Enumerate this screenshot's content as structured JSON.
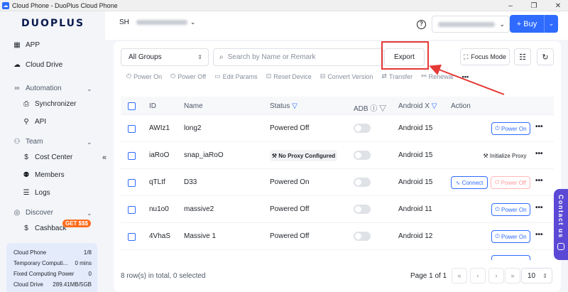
{
  "window": {
    "title": "Cloud Phone - DuoPlus Cloud Phone",
    "controls": [
      "–",
      "❐",
      "✕"
    ]
  },
  "sidebar": {
    "logo": "DUOPLUS",
    "items": [
      {
        "label": "APP",
        "icon": "grid-icon"
      },
      {
        "label": "Cloud Drive",
        "icon": "cloud-icon"
      },
      {
        "label": "Automation",
        "icon": "infinity-icon",
        "section": true
      },
      {
        "label": "Synchronizer",
        "icon": "sync-icon"
      },
      {
        "label": "API",
        "icon": "api-icon"
      },
      {
        "label": "Team",
        "icon": "team-icon",
        "section": true
      },
      {
        "label": "Cost Center",
        "icon": "dollar-icon"
      },
      {
        "label": "Members",
        "icon": "members-icon"
      },
      {
        "label": "Logs",
        "icon": "logs-icon"
      },
      {
        "label": "Discover",
        "icon": "compass-icon",
        "section": true
      },
      {
        "label": "Cashback",
        "icon": "cashback-icon"
      }
    ],
    "cashback_badge": "GET $$$",
    "stats": [
      {
        "label": "Cloud Phone",
        "value": "1/8"
      },
      {
        "label": "Temporary Computi...",
        "value": "0 mins"
      },
      {
        "label": "Fixed Computing Power",
        "value": "0"
      },
      {
        "label": "Cloud Drive",
        "value": "289.41MB/5GB"
      }
    ],
    "collapse_glyph": "«"
  },
  "header": {
    "account_initials": "SH",
    "help_glyph": "?",
    "buy_label": "+ Buy"
  },
  "toolbar": {
    "group_select": "All Groups",
    "search_placeholder": "Search by Name or Remark",
    "export_label": "Export",
    "focus_mode_label": "Focus Mode",
    "actions": [
      "Power On",
      "Power Off",
      "Edit Params",
      "Reset Device",
      "Convert Version",
      "Transfer",
      "Renewal"
    ],
    "more_glyph": "•••"
  },
  "table": {
    "columns": [
      "ID",
      "Name",
      "Status",
      "ADB",
      "Android X",
      "Action"
    ],
    "rows": [
      {
        "id": "AWIz1",
        "name": "long2",
        "status": "Powered Off",
        "android": "Android 15",
        "actions": [
          "Power On"
        ]
      },
      {
        "id": "iaRoO",
        "name": "snap_iaRoO",
        "status": "No Proxy Configured",
        "android": "Android 15",
        "actions": [
          "Initialize Proxy"
        ]
      },
      {
        "id": "qTLtf",
        "name": "D33",
        "status": "Powered On",
        "android": "Android 15",
        "actions": [
          "Connect",
          "Power Off"
        ]
      },
      {
        "id": "nu1o0",
        "name": "massive2",
        "status": "Powered Off",
        "android": "Android 11",
        "actions": [
          "Power On"
        ]
      },
      {
        "id": "4VhaS",
        "name": "Massive 1",
        "status": "Powered Off",
        "android": "Android 12",
        "actions": [
          "Power On"
        ]
      }
    ]
  },
  "pagination": {
    "summary": "8 row(s) in total, 0 selected",
    "page_info": "Page 1 of 1",
    "page_size": "10",
    "buttons": [
      "«",
      "‹",
      "›",
      "»"
    ]
  },
  "contact_tab": "Contact us",
  "colors": {
    "accent": "#2f6bff",
    "highlight": "#e53935",
    "contact": "#5b49d6"
  }
}
